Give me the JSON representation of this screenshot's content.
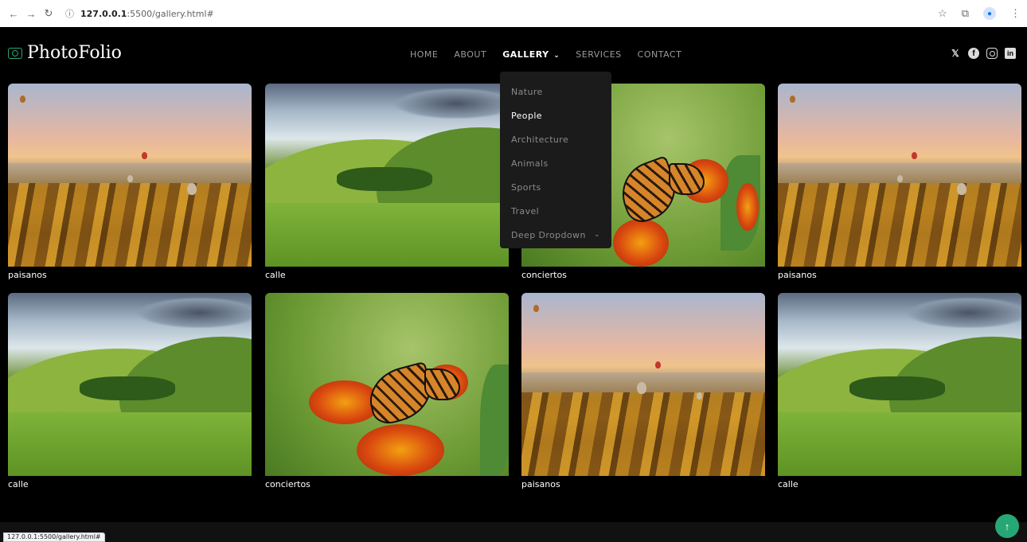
{
  "browser": {
    "url_host": "127.0.0.1",
    "url_path": ":5500/gallery.html#",
    "status_url": "127.0.0.1:5500/gallery.html#"
  },
  "site": {
    "logo": "PhotoFolio",
    "nav": [
      "HOME",
      "ABOUT",
      "GALLERY",
      "SERVICES",
      "CONTACT"
    ],
    "active_nav": "GALLERY",
    "dropdown": [
      "Nature",
      "People",
      "Architecture",
      "Animals",
      "Sports",
      "Travel",
      "Deep Dropdown"
    ],
    "dropdown_highlight": "People",
    "accent_color": "#27a776",
    "socials": [
      "x-icon",
      "facebook-icon",
      "instagram-icon",
      "linkedin-icon"
    ]
  },
  "gallery": {
    "captions": [
      "paisanos",
      "calle",
      "conciertos",
      "paisanos",
      "calle",
      "conciertos",
      "paisanos",
      "calle"
    ]
  }
}
